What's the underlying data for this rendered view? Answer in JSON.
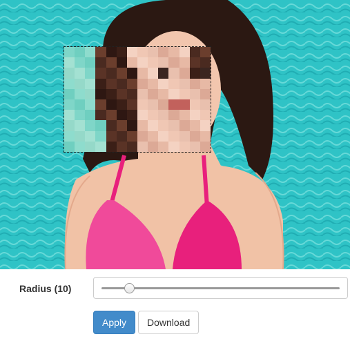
{
  "image_editor": {
    "photo_alt": "woman in pink bikini by pool",
    "pixelate_region": {
      "grid_cols": 14,
      "grid_rows": 10
    }
  },
  "controls": {
    "radius_label": "Radius (10)",
    "radius_value": 10,
    "radius_min": 0,
    "radius_max": 100,
    "apply_label": "Apply",
    "download_label": "Download"
  },
  "colors": {
    "pool_water": "#2ec4c7",
    "apply_button": "#428bca",
    "bikini": "#e8207c"
  }
}
